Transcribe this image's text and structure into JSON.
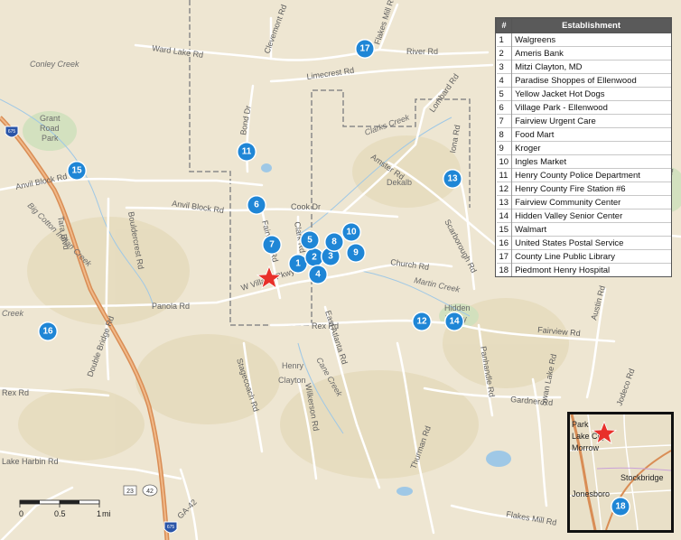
{
  "legend": {
    "col_num": "#",
    "col_name": "Establishment",
    "rows": [
      {
        "num": "1",
        "name": "Walgreens"
      },
      {
        "num": "2",
        "name": "Ameris Bank"
      },
      {
        "num": "3",
        "name": "Mitzi Clayton, MD"
      },
      {
        "num": "4",
        "name": "Paradise Shoppes of Ellenwood"
      },
      {
        "num": "5",
        "name": "Yellow Jacket Hot Dogs"
      },
      {
        "num": "6",
        "name": "Village Park - Ellenwood"
      },
      {
        "num": "7",
        "name": "Fairview Urgent Care"
      },
      {
        "num": "8",
        "name": "Food Mart"
      },
      {
        "num": "9",
        "name": "Kroger"
      },
      {
        "num": "10",
        "name": "Ingles Market"
      },
      {
        "num": "11",
        "name": "Henry County Police Department"
      },
      {
        "num": "12",
        "name": "Henry County Fire Station #6"
      },
      {
        "num": "13",
        "name": "Fairview Community Center"
      },
      {
        "num": "14",
        "name": "Hidden Valley Senior Center"
      },
      {
        "num": "15",
        "name": "Walmart"
      },
      {
        "num": "16",
        "name": "United States Postal Service"
      },
      {
        "num": "17",
        "name": "County Line Public Library"
      },
      {
        "num": "18",
        "name": "Piedmont Henry Hospital"
      }
    ]
  },
  "map_labels": {
    "ward_lake": "Ward Lake Rd",
    "clevemont": "Clevemont Rd",
    "flakes_mill": "Flakes Mill Rd",
    "river": "River Rd",
    "conley_creek": "Conley Creek",
    "grant": "Grant",
    "road": "Road",
    "park": "Park",
    "limecrest": "Limecrest Rd",
    "clarks_creek": "Clarks Creek",
    "lombard": "Lombard Rd",
    "bond": "Bond Dr",
    "anvil_block_left": "Anvil Block Rd",
    "anvil_block_mid": "Anvil Block Rd",
    "amster": "Amster Rd",
    "dekalb": "Dekalb",
    "cook": "Cook Dr",
    "fairview_road_v": "Fairview Rd",
    "clark": "Clark Rd",
    "boulder_crest": "Bouldercrest Rd",
    "forrest_park": "Forrest Park Rd",
    "big_cotton": "Big Cotton Indian Creek",
    "tarral_ste": "Tara Blvd",
    "church": "Church Rd",
    "scarborough": "Scarborough Rd",
    "martin_creek": "Martin Creek",
    "w_village": "W Village Pkwy",
    "panola": "Panola Rd",
    "hidden": "Hidden",
    "valley": "Valley",
    "rex_left": "Rex Rd",
    "rex_mid": "Rex Rd",
    "east_atlanta": "East Atlanta Rd",
    "fairview_right": "Fairview Rd",
    "austin": "Austin Rd",
    "creek_left": "Creek",
    "double_bridge": "Double Bridge Rd",
    "henry": "Henry",
    "clayton": "Clayton",
    "cane_creek": "Cane Creek",
    "stagecoach": "Stagecoach Rd",
    "wilkerson": "Wilkerson Rd",
    "thurman": "Thurman Rd",
    "panhandle": "Panhandle Rd",
    "gardner": "Gardner Rd",
    "swan_lake": "Swan Lake Rd",
    "jodeco": "Jodeco Rd",
    "lake_harbin": "Lake Harbin Rd",
    "flakes_bottom": "Flakes Mill Rd",
    "hwy23": "23",
    "hwy42": "42",
    "ga42": "GA-42",
    "i675_top": "675",
    "i675_bottom": "675",
    "pebble_rd": "Iona Rd",
    "pebble2": "Tara Rd"
  },
  "markers": [
    "1",
    "2",
    "3",
    "4",
    "5",
    "6",
    "7",
    "8",
    "9",
    "10",
    "11",
    "12",
    "13",
    "14",
    "15",
    "16",
    "17"
  ],
  "inset": {
    "labels": {
      "park": "Park",
      "lake_city": "Lake City",
      "morrow": "Morrow",
      "stockbridge": "Stockbridge",
      "jonesboro": "Jonesboro"
    },
    "marker": "18"
  },
  "scale": {
    "t0": "0",
    "t1": "0.5",
    "t2": "1",
    "unit": "mi"
  },
  "colors": {
    "marker_fill": "#1f86d6",
    "star": "#e8302a",
    "interstate": "#d98d55",
    "background": "#eee6d2",
    "road": "#ffffff",
    "water": "#9fc8e6",
    "boundary": "#8a8a8a"
  }
}
